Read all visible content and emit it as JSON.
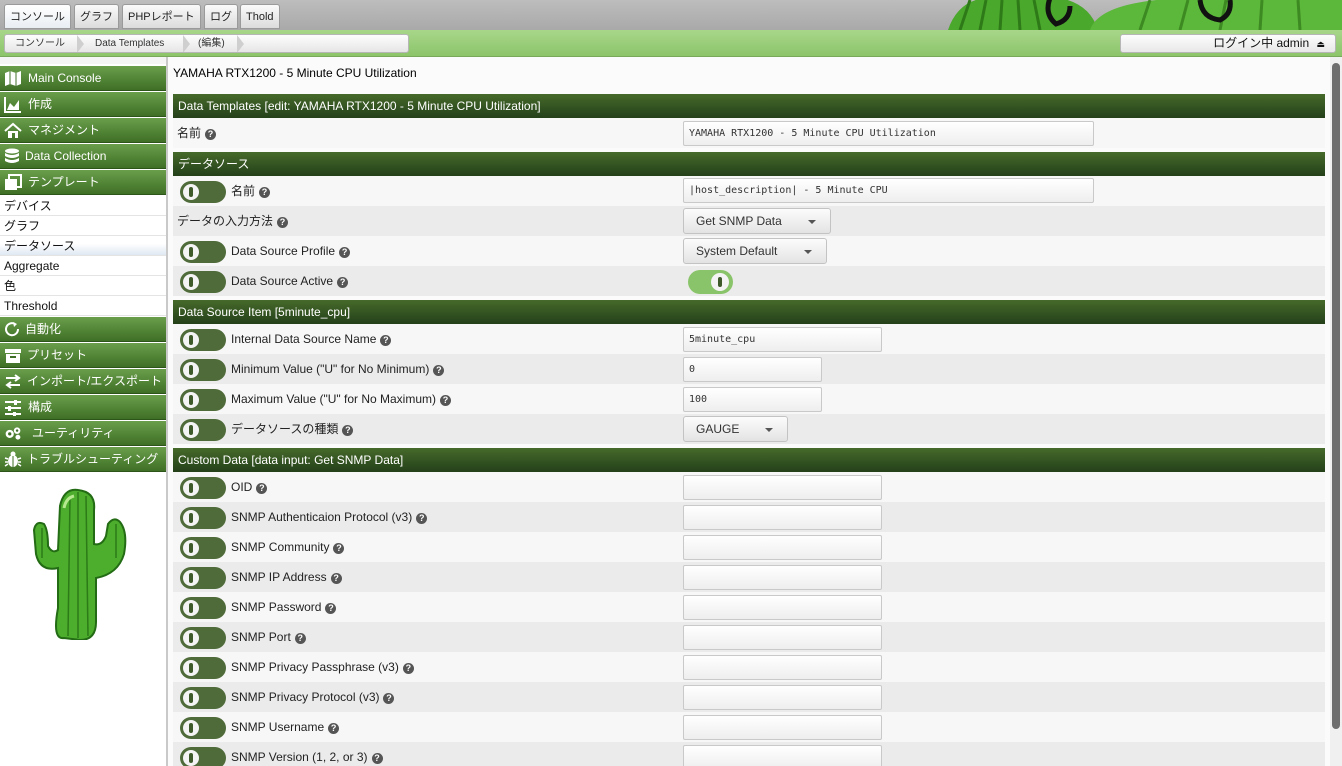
{
  "top_tabs": [
    {
      "label": "コンソール",
      "active": true
    },
    {
      "label": "グラフ",
      "active": false
    },
    {
      "label": "PHPレポート",
      "active": false
    },
    {
      "label": "ログ",
      "active": false
    },
    {
      "label": "Thold",
      "active": false
    }
  ],
  "breadcrumb": [
    "コンソール",
    "Data Templates",
    "(編集)"
  ],
  "login": {
    "label": "ログイン中 admin",
    "icon": "eject-icon"
  },
  "sidebar": {
    "groups": [
      {
        "label": "Main Console",
        "icon": "map-icon"
      },
      {
        "label": "作成",
        "icon": "chart-area-icon"
      },
      {
        "label": "マネジメント",
        "icon": "home-icon"
      },
      {
        "label": "Data Collection",
        "icon": "database-icon"
      },
      {
        "label": "テンプレート",
        "icon": "copy-icon"
      },
      {
        "label": "自動化",
        "icon": "refresh-icon"
      },
      {
        "label": "プリセット",
        "icon": "archive-icon"
      },
      {
        "label": "インポート/エクスポート",
        "icon": "exchange-icon"
      },
      {
        "label": "構成",
        "icon": "sliders-icon"
      },
      {
        "label": "ユーティリティ",
        "icon": "cogs-icon"
      },
      {
        "label": "トラブルシューティング",
        "icon": "bug-icon"
      }
    ],
    "template_items": [
      "デバイス",
      "グラフ",
      "データソース",
      "Aggregate",
      "色",
      "Threshold"
    ],
    "selected_item": "データソース"
  },
  "page": {
    "title": "YAMAHA RTX1200 - 5 Minute CPU Utilization"
  },
  "sections": {
    "template": {
      "header": "Data Templates [edit: YAMAHA RTX1200 - 5 Minute CPU Utilization]",
      "name_label": "名前",
      "name_value": "YAMAHA RTX1200 - 5 Minute CPU Utilization"
    },
    "datasource": {
      "header": "データソース",
      "name_label": "名前",
      "name_value": "|host_description| - 5 Minute CPU",
      "input_method_label": "データの入力方法",
      "input_method_value": "Get SNMP Data",
      "profile_label": "Data Source Profile",
      "profile_value": "System Default",
      "active_label": "Data Source Active",
      "active_value": true
    },
    "item": {
      "header": "Data Source Item [5minute_cpu]",
      "internal_name_label": "Internal Data Source Name",
      "internal_name_value": "5minute_cpu",
      "min_label": "Minimum Value (\"U\" for No Minimum)",
      "min_value": "0",
      "max_label": "Maximum Value (\"U\" for No Maximum)",
      "max_value": "100",
      "type_label": "データソースの種類",
      "type_value": "GAUGE"
    },
    "custom": {
      "header": "Custom Data [data input: Get SNMP Data]",
      "fields": [
        {
          "label": "OID",
          "value": ""
        },
        {
          "label": "SNMP Authenticaion Protocol (v3)",
          "value": ""
        },
        {
          "label": "SNMP Community",
          "value": ""
        },
        {
          "label": "SNMP IP Address",
          "value": ""
        },
        {
          "label": "SNMP Password",
          "value": ""
        },
        {
          "label": "SNMP Port",
          "value": ""
        },
        {
          "label": "SNMP Privacy Passphrase (v3)",
          "value": ""
        },
        {
          "label": "SNMP Privacy Protocol (v3)",
          "value": ""
        },
        {
          "label": "SNMP Username",
          "value": ""
        },
        {
          "label": "SNMP Version (1, 2, or 3)",
          "value": ""
        }
      ]
    }
  },
  "colors": {
    "header_green": "#466a2a",
    "toggle_on": "#8ac46a",
    "menu_green": "#4f8434"
  }
}
